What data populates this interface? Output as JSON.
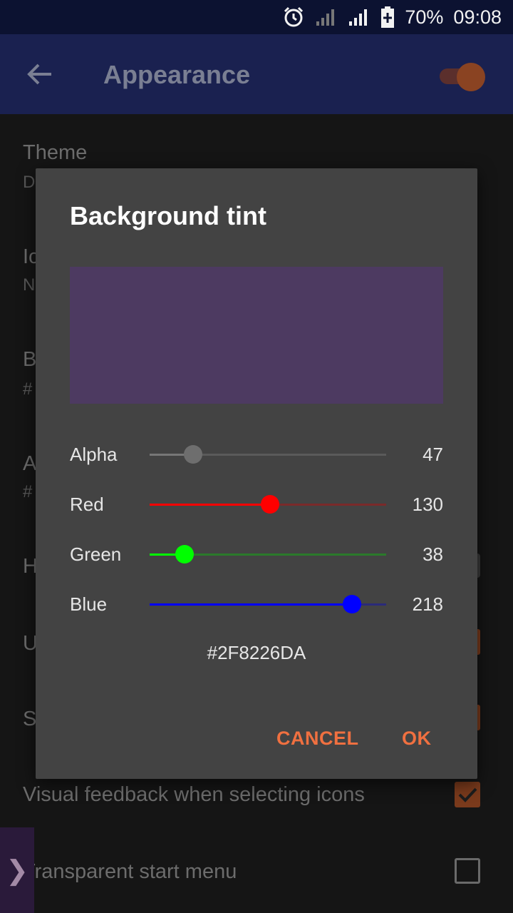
{
  "status_bar": {
    "battery": "70%",
    "time": "09:08"
  },
  "app_bar": {
    "title": "Appearance",
    "master_toggle_on": true
  },
  "background_settings": {
    "theme_label": "Theme",
    "theme_value_partial": "D",
    "row2_label_partial": "Ic",
    "row2_value_partial": "N",
    "row3_label_partial": "B",
    "row3_value_partial": "#",
    "row4_label_partial": "A",
    "row4_value_partial": "#",
    "row5_label_partial": "H",
    "row6_label_partial": "U",
    "row7_label_partial": "S",
    "visual_feedback_label": "Visual feedback when selecting icons",
    "transparent_start_label": "Transparent start menu"
  },
  "start_tab_glyph": "❯",
  "dialog": {
    "title": "Background tint",
    "preview_color": "#4d3a61",
    "sliders": [
      {
        "label": "Alpha",
        "value": "47",
        "fraction": 0.184,
        "fill": "#777777",
        "rest": "#5a5a5a",
        "thumb": "#6e6e6e"
      },
      {
        "label": "Red",
        "value": "130",
        "fraction": 0.51,
        "fill": "#ff0000",
        "rest": "#7a2a2a",
        "thumb": "#ff0000"
      },
      {
        "label": "Green",
        "value": "38",
        "fraction": 0.149,
        "fill": "#00ff00",
        "rest": "#2a7a2a",
        "thumb": "#00ff00"
      },
      {
        "label": "Blue",
        "value": "218",
        "fraction": 0.855,
        "fill": "#0000ff",
        "rest": "#2a2a7a",
        "thumb": "#0000ff"
      }
    ],
    "hex_value": "#2F8226DA",
    "cancel_label": "CANCEL",
    "ok_label": "OK"
  },
  "colors": {
    "accent": "#f07040",
    "app_bar": "#1a2150",
    "status_bar": "#0c1231"
  }
}
